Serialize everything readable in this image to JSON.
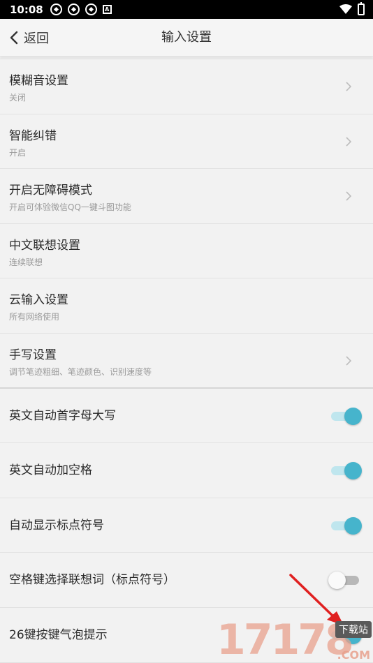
{
  "status_bar": {
    "time": "10:08",
    "icons": [
      "pinwheel-icon",
      "pinwheel-icon",
      "pinwheel-icon",
      "a-box-icon",
      "wifi-icon",
      "battery-icon"
    ]
  },
  "app_bar": {
    "back_label": "返回",
    "title": "输入设置"
  },
  "settings": [
    {
      "title": "模糊音设置",
      "subtitle": "关闭",
      "control": "chevron"
    },
    {
      "title": "智能纠错",
      "subtitle": "开启",
      "control": "chevron"
    },
    {
      "title": "开启无障碍模式",
      "subtitle": "开启可体验微信QQ一键斗图功能",
      "control": "chevron"
    },
    {
      "title": "中文联想设置",
      "subtitle": "连续联想",
      "control": "none"
    },
    {
      "title": "云输入设置",
      "subtitle": "所有网络使用",
      "control": "none"
    },
    {
      "title": "手写设置",
      "subtitle": "调节笔迹粗细、笔迹颜色、识别速度等",
      "control": "chevron"
    },
    {
      "title": "英文自动首字母大写",
      "control": "toggle",
      "on": true
    },
    {
      "title": "英文自动加空格",
      "control": "toggle",
      "on": true
    },
    {
      "title": "自动显示标点符号",
      "control": "toggle",
      "on": true
    },
    {
      "title": "空格键选择联想词（标点符号）",
      "control": "toggle",
      "on": false
    },
    {
      "title": "26键按键气泡提示",
      "control": "toggle",
      "on": true
    }
  ],
  "watermark": {
    "digits": "17178",
    "badge": "下载站",
    "suffix": ".COM"
  },
  "colors": {
    "accent": "#46b4cc",
    "accent_track": "#bfe6ee",
    "arrow": "#e02020"
  }
}
